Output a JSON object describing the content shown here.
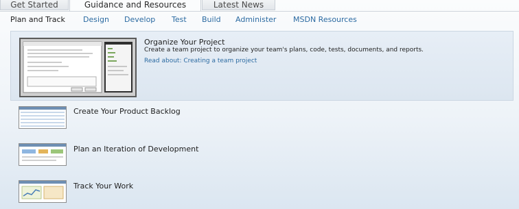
{
  "tabs": [
    {
      "label": "Get Started",
      "active": false
    },
    {
      "label": "Guidance and Resources",
      "active": true
    },
    {
      "label": "Latest News",
      "active": false
    }
  ],
  "subnav": [
    "Plan and Track",
    "Design",
    "Develop",
    "Test",
    "Build",
    "Administer",
    "MSDN Resources"
  ],
  "featured": {
    "title": "Organize Your Project",
    "description": "Create a team project to organize your team's plans, code, tests, documents, and reports.",
    "link": "Read about: Creating a team project"
  },
  "items": [
    {
      "title": "Create Your Product Backlog"
    },
    {
      "title": "Plan an Iteration of Development"
    },
    {
      "title": "Track Your Work"
    }
  ],
  "colors": {
    "link": "#2b6aa1",
    "card_bg": "#e2eaf3",
    "tab_border": "#c9cfd6"
  }
}
